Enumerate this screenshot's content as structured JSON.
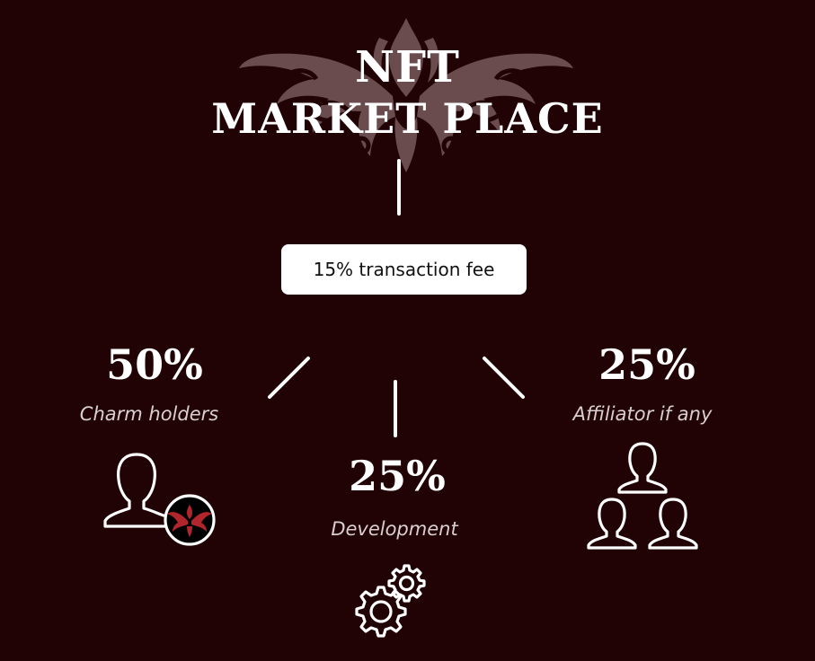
{
  "title": {
    "line1": "NFT",
    "line2": "MARKET PLACE"
  },
  "fee": {
    "label": "15% transaction fee"
  },
  "splits": [
    {
      "percent": "50%",
      "label": "Charm holders",
      "icon": "user-with-mask-badge-icon"
    },
    {
      "percent": "25%",
      "label": "Development",
      "icon": "gears-icon"
    },
    {
      "percent": "25%",
      "label": "Affiliator if any",
      "icon": "user-group-icon"
    }
  ],
  "colors": {
    "background": "#220305",
    "mask_watermark": "#6a4c4e",
    "text": "#ffffff",
    "label_text": "#d9cfd0",
    "fee_box": "#ffffff",
    "badge_mask": "#b0262c"
  }
}
